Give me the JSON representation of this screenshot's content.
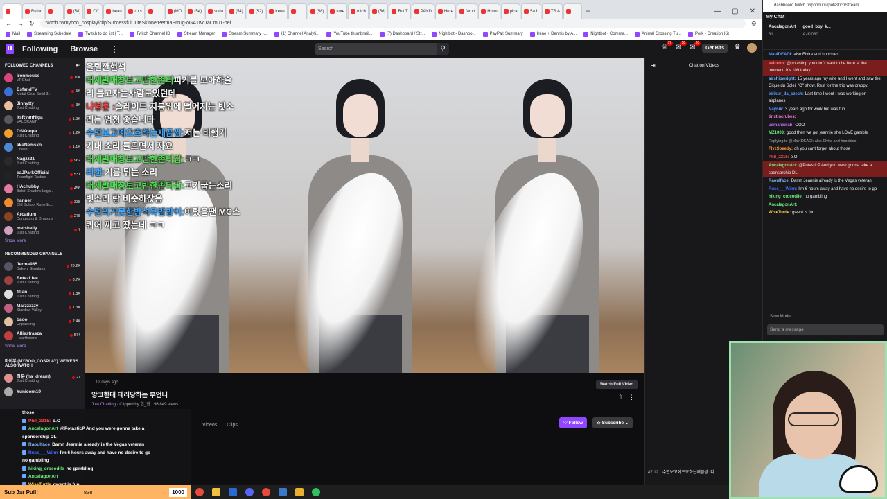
{
  "browser": {
    "tabs": [
      "",
      "Refor",
      "",
      "(58)",
      "Off",
      "beau",
      "zo s",
      "",
      "(MO",
      "(54)",
      "soda",
      "(54)",
      "(52)",
      "irene",
      "",
      "(58)",
      "kore",
      "mich",
      "(56)",
      "But T",
      "PAND",
      "Here",
      "famb",
      "Hmm",
      "pica",
      "Sa h",
      "TS A",
      ""
    ],
    "address": "twitch.tv/myboo_cosplay/clip/SuccessfulCuteSkinnetPermaSmug-oGA1wcTaCmu1-hel",
    "bookmarks": [
      "Mail",
      "Streaming Schedule",
      "Twitch to do list | T...",
      "Twitch Channel ID",
      "Stream Manager",
      "Stream Summary -...",
      "(1) Channel Analyti...",
      "YouTube thumbnail...",
      "(7) Dashboard / Str...",
      "Nightbot - Dashbo...",
      "PayPal: Summary",
      "Irene + Dennis by A...",
      "Nightbot - Comma...",
      "Animal Crossing Tu...",
      "Perk - Creation Kit"
    ]
  },
  "header": {
    "following": "Following",
    "browse": "Browse",
    "search_placeholder": "Search",
    "badges": [
      "77",
      "58",
      "20"
    ],
    "get_bits": "Get Bits"
  },
  "sidebar": {
    "followed_title": "FOLLOWED CHANNELS",
    "followed": [
      {
        "name": "ironmouse",
        "game": "VRChat",
        "viewers": "11K",
        "color": "#d9467b"
      },
      {
        "name": "EsfandTV",
        "game": "Metal Gear Solid 3...",
        "viewers": "5K",
        "color": "#3b6fd1"
      },
      {
        "name": "Jinnytty",
        "game": "Just Chatting",
        "viewers": "3K",
        "color": "#e8c0a0"
      },
      {
        "name": "ItsRyanHiga",
        "game": "VALORANT",
        "viewers": "1.9K",
        "color": "#5a5a5a"
      },
      {
        "name": "DSKoopa",
        "game": "Just Chatting",
        "viewers": "1.2K",
        "color": "#f0a030"
      },
      {
        "name": "akaNemsko",
        "game": "Chess",
        "viewers": "1.1K",
        "color": "#4a8ad4"
      },
      {
        "name": "Nagzz21",
        "game": "Just Chatting",
        "viewers": "962",
        "color": "#2a2a2a"
      },
      {
        "name": "eaJParkOfficial",
        "game": "Teamfight Tactics",
        "viewers": "531",
        "color": "#222"
      },
      {
        "name": "HAchubby",
        "game": "Baldi: Shadow Lega...",
        "viewers": "456",
        "color": "#e07aa0"
      },
      {
        "name": "hanner",
        "game": "Old School RuneSc...",
        "viewers": "338",
        "color": "#f08a30"
      },
      {
        "name": "Arcadum",
        "game": "Dungeons & Dragons",
        "viewers": "278",
        "color": "#884422"
      },
      {
        "name": "meishelly",
        "game": "Just Chatting",
        "viewers": "7",
        "color": "#d0a0c0"
      }
    ],
    "show_more": "Show More",
    "recommended_title": "RECOMMENDED CHANNELS",
    "recommended": [
      {
        "name": "Jerma985",
        "game": "Bakery Simulator",
        "viewers": "20.2K",
        "color": "#556"
      },
      {
        "name": "BotezLive",
        "game": "Just Chatting",
        "viewers": "8.7K",
        "color": "#a04040"
      },
      {
        "name": "fillan",
        "game": "Just Chatting",
        "viewers": "1.8K",
        "color": "#ddd"
      },
      {
        "name": "Marzzzzzy",
        "game": "Stardew Valley",
        "viewers": "1.3K",
        "color": "#c06080"
      },
      {
        "name": "baoo",
        "game": "Unpacking",
        "viewers": "2.4K",
        "color": "#e0c0a0"
      },
      {
        "name": "Alliestrasza",
        "game": "Hearthstone",
        "viewers": "574",
        "color": "#c04040"
      }
    ],
    "show_more2": "Show More",
    "also_watch_title": "마이부 (MYBOO_COSPLAY) VIEWERS ALSO WATCH",
    "also_watch": [
      {
        "name": "하윤 (ha_dream)",
        "game": "Just Chatting",
        "viewers": "27",
        "color": "#e09090"
      },
      {
        "name": "Yunicorn19",
        "game": "",
        "viewers": "",
        "color": "#aaa"
      }
    ]
  },
  "video": {
    "overlay_chat": [
      {
        "user": "",
        "text": "을텔깐현석",
        "ucls": ""
      },
      {
        "user": "대세발매창보고반한존티",
        "text": "피기를 모아하슬",
        "ucls": "u3"
      },
      {
        "user": "",
        "text": "리 틀고자는사람도있던데",
        "ucls": ""
      },
      {
        "user": "나영훈 :",
        "text": "슬레이트 지붕위에 떨어지는 빗소",
        "ucls": "u"
      },
      {
        "user": "",
        "text": "리는 엄청 좋습니다",
        "ucls": ""
      },
      {
        "user": "수면보고예으흐하는재끔쌍:",
        "text": "저는 비행기",
        "ucls": "u2"
      },
      {
        "user": "",
        "text": "기내 소리 들으면서 자요",
        "ucls": ""
      },
      {
        "user": "대세발매창보고반한존티갑:",
        "text": "ㅋㅋ",
        "ucls": "u3"
      },
      {
        "user": "리갠:",
        "text": "기름 튀는 소리",
        "ucls": "u2"
      },
      {
        "user": "대세발매창보고반한존티갑:",
        "text": "고기굽는소리",
        "ucls": "u3"
      },
      {
        "user": "",
        "text": "빗소리 랑 비슷하잖음",
        "ucls": ""
      },
      {
        "user": "수면의거못한방석욕밤방이:",
        "text": "어렸을땐 MC스",
        "ucls": "u2"
      },
      {
        "user": "",
        "text": "퀴어 끼고 잤는데 ㅋㅋ",
        "ucls": ""
      }
    ]
  },
  "clip": {
    "ago": "12 days ago",
    "title": "앙코한테 테러당하는 부언니",
    "category": "Just Chatting",
    "clipped_by": "· Clipped by 힌_힌 · 96,849 views",
    "watch_full": "Watch Full Video",
    "tabs": [
      "Videos",
      "Clips"
    ],
    "follow": "Follow",
    "subscribe": "Subscribe"
  },
  "chat_videos": {
    "title": "Chat on Videos",
    "bottom_time": "47:12",
    "bottom_text": "수면보고예으흐하는재끔쌍: 티"
  },
  "stream_chat": [
    {
      "user": "",
      "text": "those",
      "color": "#fff"
    },
    {
      "user": "Phil_2215:",
      "text": "o.O",
      "color": "#ff4a4a"
    },
    {
      "user": "AncalagonArt",
      "text": "@PotasticP And you were gonna take a",
      "color": "#6cf07a"
    },
    {
      "user": "",
      "text": "sponsorship DL",
      "color": "#fff"
    },
    {
      "user": "Raoulface",
      "text": "Damn Jeannie already is the Vegas veteran",
      "color": "#7fb6ff"
    },
    {
      "user": "Russ___Winn",
      "text": "I'm 6 hours away and have no desire to go",
      "color": "#3f6bff"
    },
    {
      "user": "",
      "text": "no gambling",
      "color": "#fff"
    },
    {
      "user": "hiking_crocodile",
      "text": "no gambling",
      "color": "#6cf07a"
    },
    {
      "user": "AncalagonArt",
      "text": "",
      "color": "#6cf07a"
    },
    {
      "user": "WiseTurtle",
      "text": "gwent is fun",
      "color": "#ffd94a"
    }
  ],
  "mychat": {
    "url": "dashboard.twitch.tv/popout/u/potasticp/stream...",
    "title": "My Chat",
    "top": [
      {
        "name": "AncalagonArt",
        "sub": "31"
      },
      {
        "name": "good_boy_k...",
        "sub": "AzKi080"
      }
    ],
    "lines": [
      {
        "user": "Mat4DEADI:",
        "text": "also Elvira and hoochies",
        "color": "#5b9bff",
        "hl": false
      },
      {
        "user": "evicevo:",
        "text": "@potasticp you don't want to be here at the moment. It's 109 today.",
        "color": "#ff7a7a",
        "hl": true
      },
      {
        "user": "airshipwright:",
        "text": "15 years ago my wife and I went and saw the Cique du Soleil \"O\" show. Rest for the trip was crappy.",
        "color": "#7fb6ff",
        "hl": false
      },
      {
        "user": "eirikur_da_czech:",
        "text": "Last time I went I was working on airplanes",
        "color": "#5b9bff",
        "hl": false
      },
      {
        "user": "Naynik:",
        "text": "3 years ago for work but was fun",
        "color": "#5b9bff",
        "hl": false
      },
      {
        "user": "tinstincrubes:",
        "text": "",
        "color": "#ff7ad9",
        "hl": false
      },
      {
        "user": "usmanawab:",
        "text": "OOO",
        "color": "#c06cff",
        "hl": false
      },
      {
        "user": "MZ1003:",
        "text": "good then we got jeannie she LOVE gamble",
        "color": "#6cf07a",
        "hl": false
      },
      {
        "user": "",
        "text": "Replying to @Mat4DEADI: also Elvira and hoochies",
        "color": "#adadb8",
        "hl": false,
        "rep": true
      },
      {
        "user": "FlyzSpeedy:",
        "text": "oh you cant forget about those",
        "color": "#ff9a3c",
        "hl": false
      },
      {
        "user": "Phil_2215:",
        "text": "o.O",
        "color": "#ff4a4a",
        "hl": false
      },
      {
        "user": "AncalagonArt:",
        "text": "@PotasticP And you were gonna take a sponsorship DL",
        "color": "#6cf07a",
        "hl": true
      },
      {
        "user": "Raoulface:",
        "text": "Damn Jeannie already is the Vegas veteran",
        "color": "#7fb6ff",
        "hl": false
      },
      {
        "user": "Russ___Winn:",
        "text": "I'm 6 hours away and have no desire to go",
        "color": "#3f6bff",
        "hl": false
      },
      {
        "user": "hiking_crocodile:",
        "text": "no gambling",
        "color": "#6cf07a",
        "hl": false
      },
      {
        "user": "AncalagonArt:",
        "text": "",
        "color": "#6cf07a",
        "hl": false
      },
      {
        "user": "WiseTurtle:",
        "text": "gwent is fun",
        "color": "#ffd94a",
        "hl": false
      }
    ],
    "slow_mode": "Slow Mode",
    "send_placeholder": "Send a message"
  },
  "taskbar": {
    "sub_jar": "Sub Jar Pull!",
    "count": "838",
    "goal": "1000"
  }
}
